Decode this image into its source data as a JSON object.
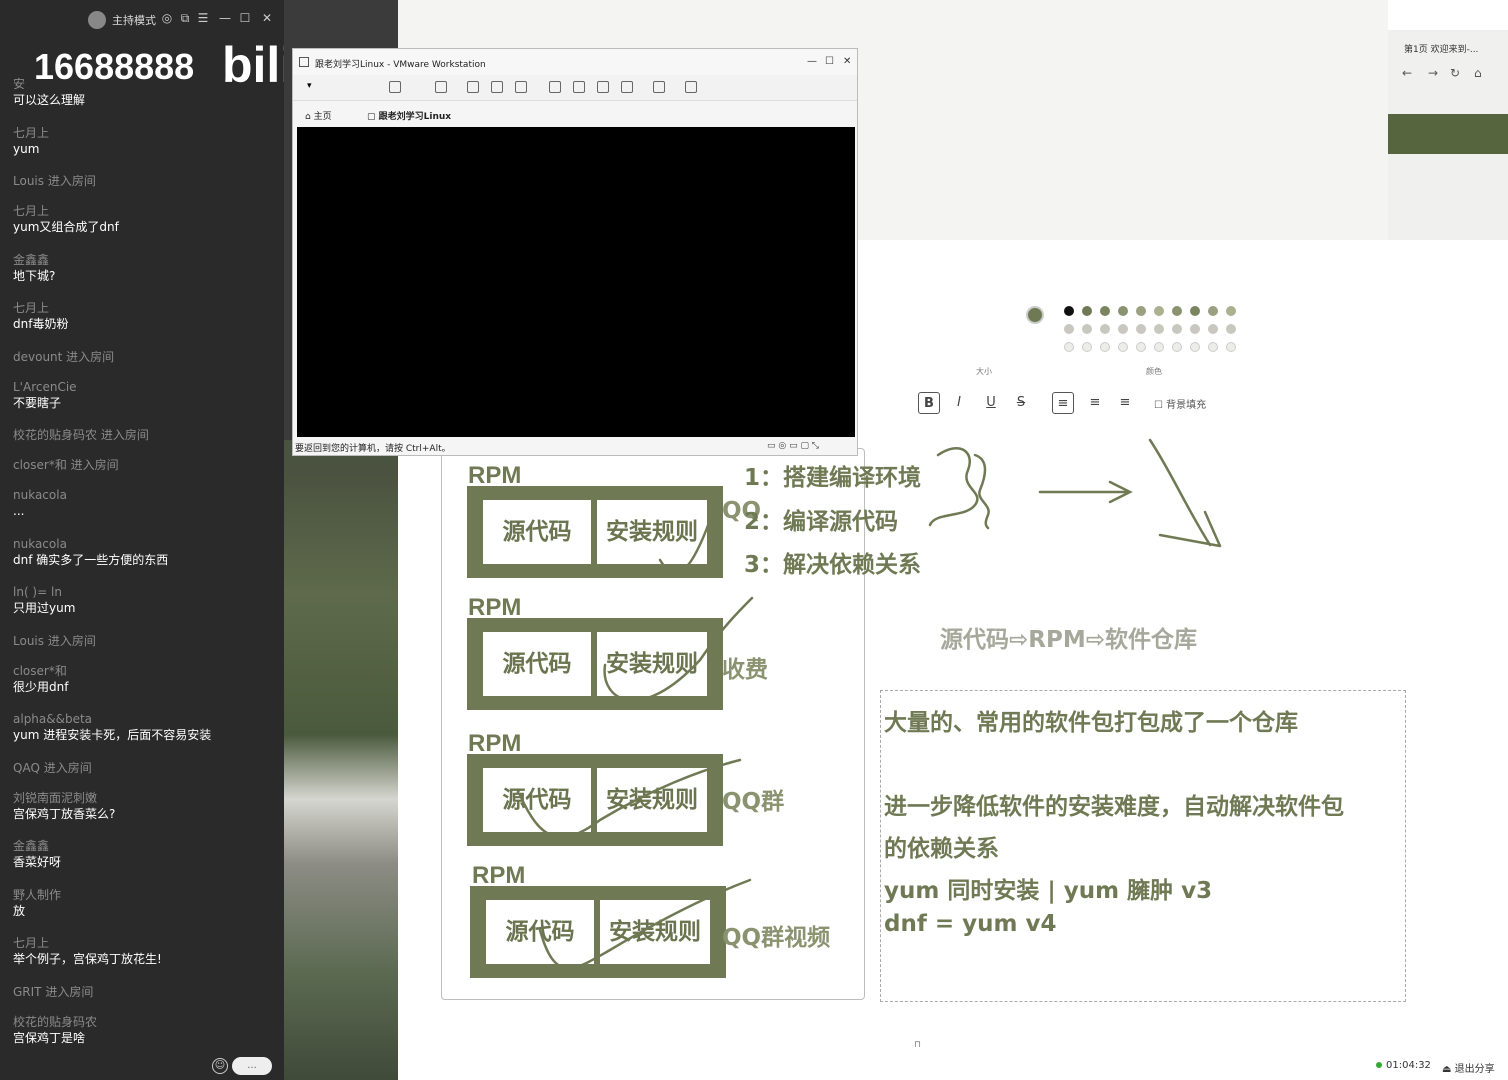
{
  "chat": {
    "mode": "主持模式",
    "overlay_number": "16688888",
    "overlay_logo": "bili",
    "messages": [
      {
        "user": "安",
        "text": "可以这么理解"
      },
      {
        "user": "七月上",
        "text": "yum"
      },
      {
        "event": "Louis 进入房间"
      },
      {
        "user": "七月上",
        "text": "yum又组合成了dnf"
      },
      {
        "user": "金鑫鑫",
        "text": "地下城?"
      },
      {
        "user": "七月上",
        "text": "dnf毒奶粉"
      },
      {
        "event": "devount 进入房间"
      },
      {
        "user": "L'ArcenCie",
        "text": "不要瞎子"
      },
      {
        "event": "校花的贴身码农 进入房间"
      },
      {
        "event": "closer*和   进入房间"
      },
      {
        "user": "nukacola",
        "text": "..."
      },
      {
        "user": "nukacola",
        "text": "dnf 确实多了一些方便的东西"
      },
      {
        "user": "ln(    )=    ln",
        "text": "只用过yum"
      },
      {
        "event": "Louis 进入房间"
      },
      {
        "user": "closer*和",
        "text": "很少用dnf"
      },
      {
        "user": "alpha&&beta",
        "text": "yum 进程安装卡死，后面不容易安装"
      },
      {
        "event": "QAQ 进入房间"
      },
      {
        "user": "刘锐南面泥刺嫩",
        "text": "宫保鸡丁放香菜么?"
      },
      {
        "user": "金鑫鑫",
        "text": "香菜好呀"
      },
      {
        "user": "野人制作",
        "text": "放"
      },
      {
        "user": "七月上",
        "text": "举个例子，宫保鸡丁放花生!"
      },
      {
        "event": "GRIT 进入房间"
      },
      {
        "user": "校花的贴身码农",
        "text": "宫保鸡丁是啥"
      }
    ],
    "send_label": "..."
  },
  "vmware": {
    "title": "跟老刘学习Linux - VMware Workstation",
    "tabs": [
      "主页",
      "跟老刘学习Linux"
    ],
    "status": "要返回到您的计算机，请按 Ctrl+Alt。"
  },
  "browser": {
    "tab": "第1页 欢迎来到-..."
  },
  "whiteboard": {
    "rpm_groups": [
      {
        "title": "RPM",
        "left": "源代码",
        "right": "安装规则",
        "note": "QQ"
      },
      {
        "title": "RPM",
        "left": "源代码",
        "right": "安装规则",
        "note": "收费"
      },
      {
        "title": "RPM",
        "left": "源代码",
        "right": "安装规则",
        "note": "QQ群"
      },
      {
        "title": "RPM",
        "left": "源代码",
        "right": "安装规则",
        "note": "QQ群视频"
      }
    ],
    "steps": [
      "1：搭建编译环境",
      "2：编译源代码",
      "3：解决依赖关系"
    ],
    "flow": "源代码⇨RPM⇨软件仓库",
    "textbox": [
      "大量的、常用的软件包打包成了一个仓库",
      "进一步降低软件的安装难度，自动解决软件包",
      "的依赖关系",
      "yum  同时安装  |  yum 臃肿   v3",
      "dnf  = yum v4"
    ],
    "toolbar": {
      "bg_fill": "背景填充",
      "labels": [
        "大小",
        "颜色"
      ]
    }
  },
  "status": {
    "timer": "01:04:32",
    "exit": "退出分享"
  },
  "colors": {
    "accent_olive": "#6f7a55",
    "chat_bg": "#2a2a2a"
  }
}
